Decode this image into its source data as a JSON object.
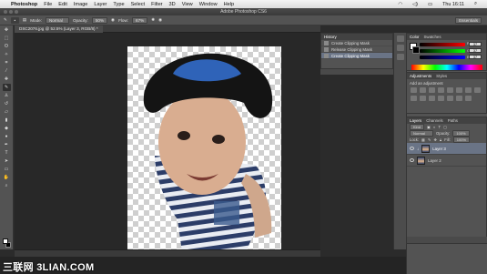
{
  "menubar": {
    "app": "Photoshop",
    "items": [
      "File",
      "Edit",
      "Image",
      "Layer",
      "Type",
      "Select",
      "Filter",
      "3D",
      "View",
      "Window",
      "Help"
    ],
    "clock": "Thu 16:11"
  },
  "window": {
    "title": "Adobe Photoshop CS6"
  },
  "options": {
    "mode_label": "Mode:",
    "mode_value": "Normal",
    "opacity_label": "Opacity:",
    "opacity_value": "50%",
    "flow_label": "Flow:",
    "flow_value": "67%",
    "workspace": "Essentials"
  },
  "document": {
    "tab_label": "DSC2076.jpg @ 52.5% (Layer 3, RGB/8) *"
  },
  "history": {
    "tabs": [
      "History"
    ],
    "items": [
      "Create Clipping Mask",
      "Release Clipping Mask",
      "Create Clipping Mask"
    ],
    "selected_index": 2
  },
  "color_panel": {
    "tabs": [
      "Color",
      "Swatches"
    ],
    "values": [
      "37",
      "37",
      "37"
    ],
    "channels": [
      "R",
      "G",
      "B"
    ]
  },
  "adjustments": {
    "tabs": [
      "Adjustments",
      "Styles"
    ],
    "caption": "Add an adjustment"
  },
  "layers": {
    "tabs": [
      "Layers",
      "Channels",
      "Paths"
    ],
    "kind_label": "Kind",
    "blend": "Normal",
    "opacity_label": "Opacity:",
    "opacity_value": "100%",
    "lock_label": "Lock:",
    "fill_label": "Fill:",
    "fill_value": "100%",
    "rows": [
      {
        "name": "Layer 3",
        "selected": true,
        "thumb": "photo"
      },
      {
        "name": "Layer 2",
        "selected": false,
        "thumb": "photo"
      }
    ]
  },
  "watermark": "三联网 3LIAN.COM",
  "colors": {
    "menubar": "#e8e8e8",
    "workspace": "#282828",
    "panel": "#535353",
    "selection": "#6a7486"
  }
}
